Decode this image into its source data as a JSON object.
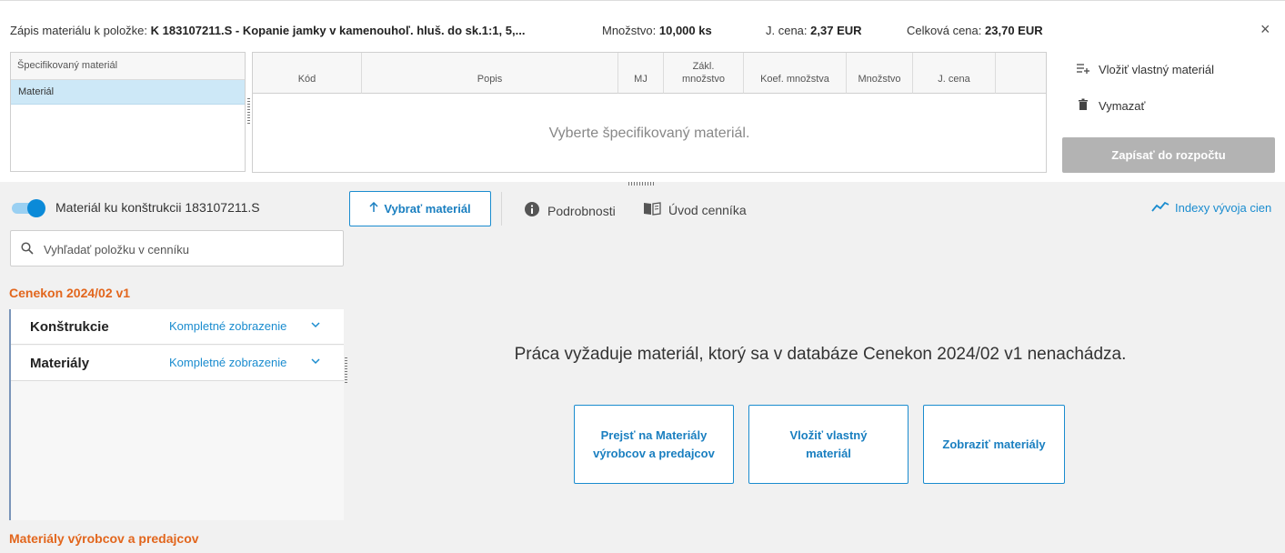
{
  "header": {
    "title_prefix": "Zápis materiálu k položke:",
    "title_item": "K 183107211.S - Kopanie jamky v kamenouhoľ. hluš. do sk.1:1, 5,...",
    "qty_label": "Množstvo:",
    "qty_value": "10,000 ks",
    "unit_price_label": "J. cena:",
    "unit_price_value": "2,37 EUR",
    "total_label": "Celková cena:",
    "total_value": "23,70 EUR",
    "close_icon": "×"
  },
  "spec_panel": {
    "header": "Špecifikovaný materiál",
    "rows": [
      "Materiál"
    ]
  },
  "grid": {
    "columns": [
      "Kód",
      "Popis",
      "MJ",
      "Zákl.\nmnožstvo",
      "Koef. množstva",
      "Množstvo",
      "J. cena",
      ""
    ],
    "empty_message": "Vyberte špecifikovaný materiál."
  },
  "actions": {
    "insert_custom": "Vložiť vlastný materiál",
    "delete": "Vymazať",
    "write_budget": "Zapísať do rozpočtu"
  },
  "toggle": {
    "label": "Materiál ku konštrukcii 183107211.S",
    "on": true
  },
  "search": {
    "placeholder": "Vyhľadať položku v cenníku"
  },
  "catalog": {
    "title": "Cenekon 2024/02 v1",
    "groups": [
      {
        "name": "Konštrukcie",
        "link": "Kompletné zobrazenie"
      },
      {
        "name": "Materiály",
        "link": "Kompletné zobrazenie"
      }
    ],
    "second_title": "Materiály výrobcov a predajcov"
  },
  "toolbar": {
    "select_material": "Vybrať materiál",
    "details": "Podrobnosti",
    "price_intro": "Úvod cenníka",
    "indexes": "Indexy vývoja cien"
  },
  "main": {
    "message": "Práca vyžaduje materiál, ktorý sa v databáze Cenekon 2024/02 v1 nenachádza.",
    "buttons": [
      "Prejsť na Materiály výrobcov a predajcov",
      "Vložiť vlastný materiál",
      "Zobraziť materiály"
    ]
  },
  "colors": {
    "accent": "#1a8ccf",
    "orange": "#e2661d",
    "disabled": "#b3b3b3",
    "selected_row": "#cde8f7"
  }
}
